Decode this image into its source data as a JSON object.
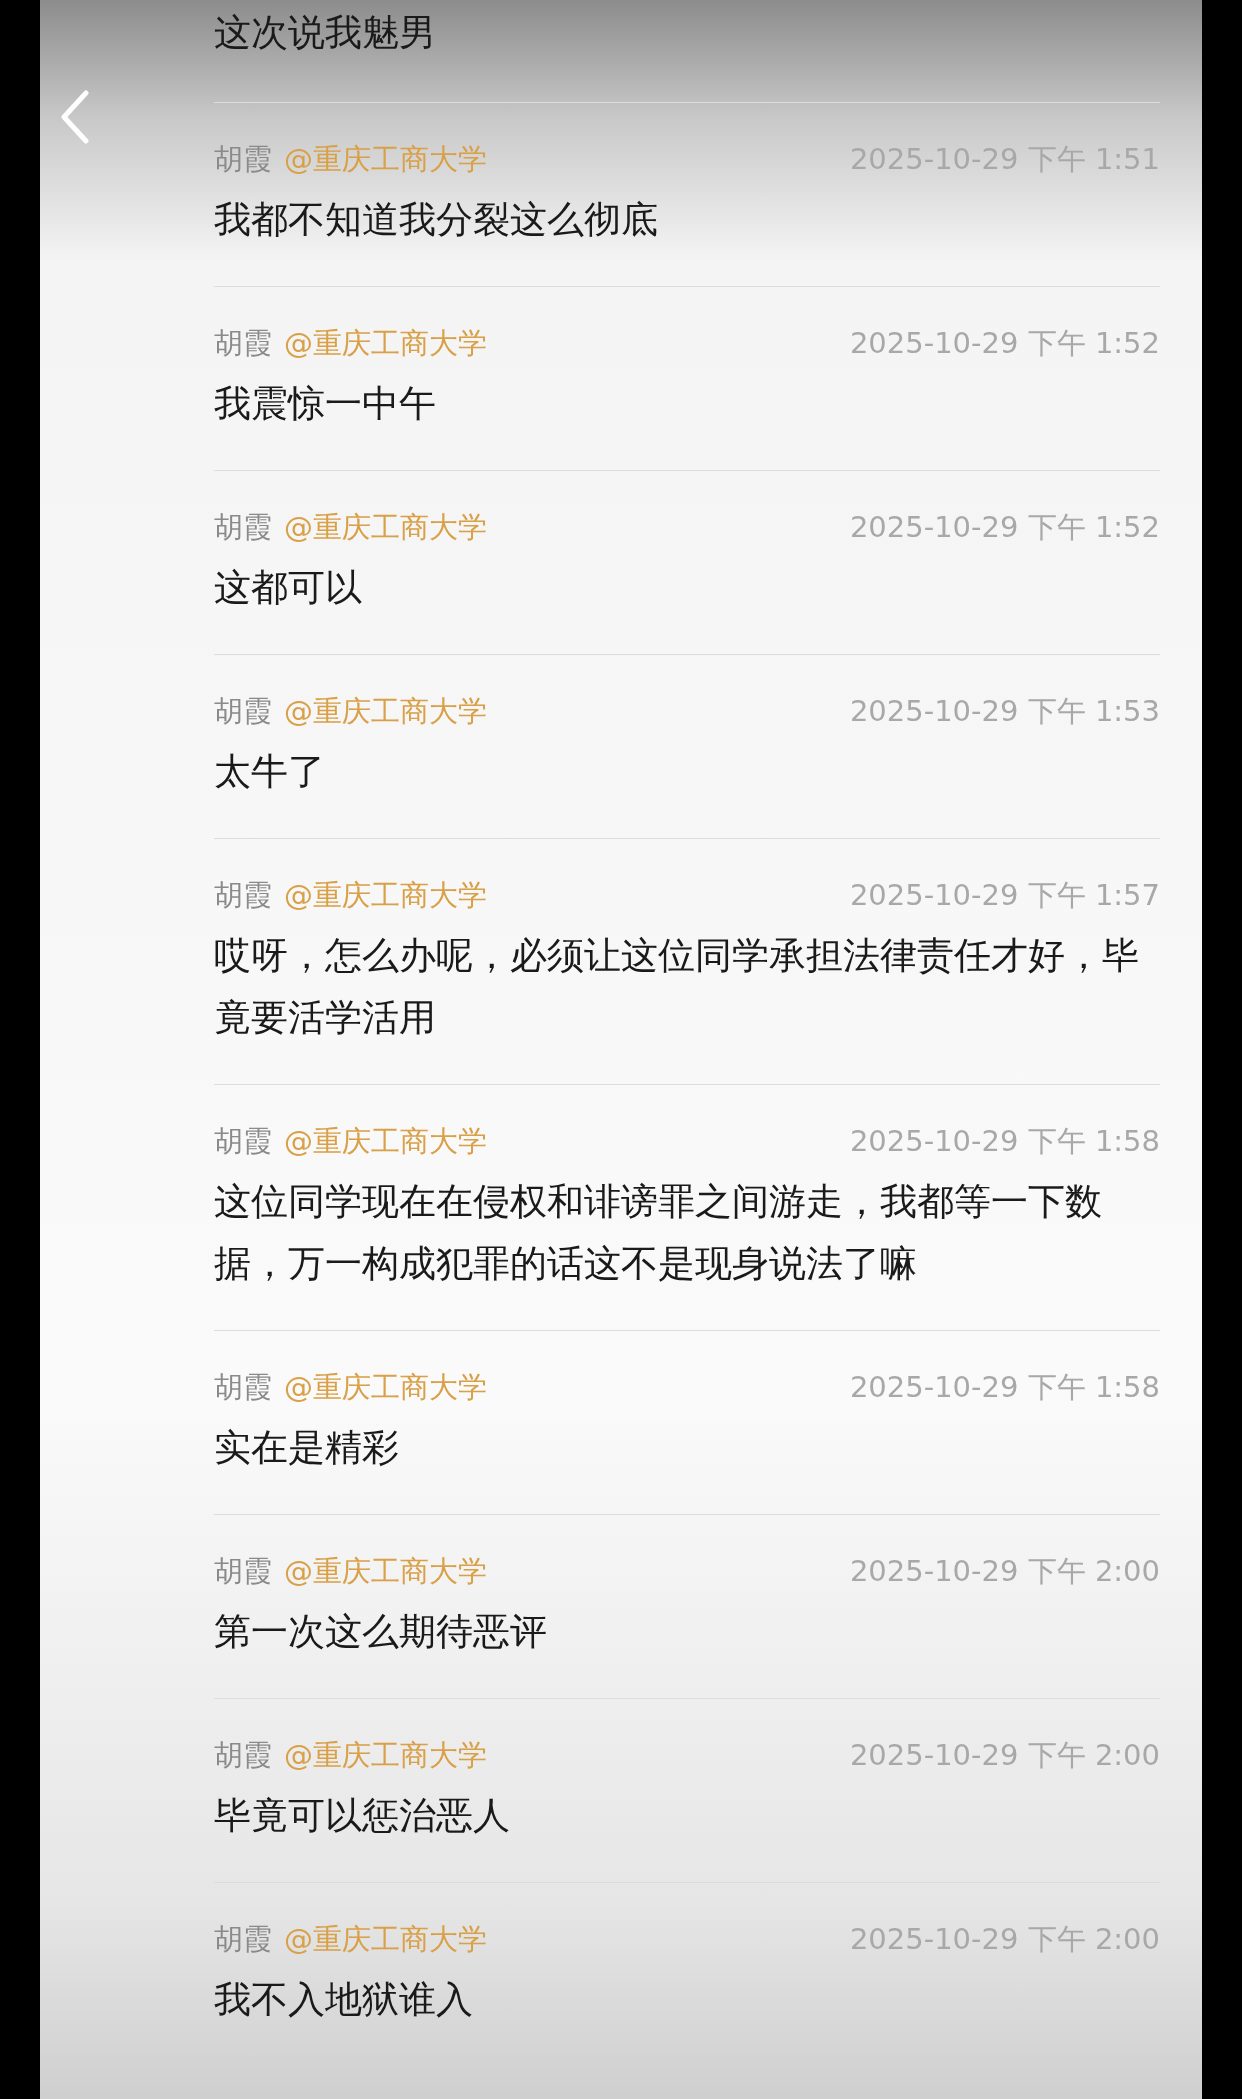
{
  "partial_comment": {
    "text": "这次说我魅男"
  },
  "comments": [
    {
      "author": "胡霞",
      "school": "@重庆工商大学",
      "time": "2025-10-29 下午 1:51",
      "text": "我都不知道我分裂这么彻底"
    },
    {
      "author": "胡霞",
      "school": "@重庆工商大学",
      "time": "2025-10-29 下午 1:52",
      "text": "我震惊一中午"
    },
    {
      "author": "胡霞",
      "school": "@重庆工商大学",
      "time": "2025-10-29 下午 1:52",
      "text": "这都可以"
    },
    {
      "author": "胡霞",
      "school": "@重庆工商大学",
      "time": "2025-10-29 下午 1:53",
      "text": "太牛了"
    },
    {
      "author": "胡霞",
      "school": "@重庆工商大学",
      "time": "2025-10-29 下午 1:57",
      "text": "哎呀，怎么办呢，必须让这位同学承担法律责任才好，毕竟要活学活用"
    },
    {
      "author": "胡霞",
      "school": "@重庆工商大学",
      "time": "2025-10-29 下午 1:58",
      "text": "这位同学现在在侵权和诽谤罪之间游走，我都等一下数据，万一构成犯罪的话这不是现身说法了嘛"
    },
    {
      "author": "胡霞",
      "school": "@重庆工商大学",
      "time": "2025-10-29 下午 1:58",
      "text": "实在是精彩"
    },
    {
      "author": "胡霞",
      "school": "@重庆工商大学",
      "time": "2025-10-29 下午 2:00",
      "text": "第一次这么期待恶评"
    },
    {
      "author": "胡霞",
      "school": "@重庆工商大学",
      "time": "2025-10-29 下午 2:00",
      "text": "毕竟可以惩治恶人"
    },
    {
      "author": "胡霞",
      "school": "@重庆工商大学",
      "time": "2025-10-29 下午 2:00",
      "text": "我不入地狱谁入"
    }
  ]
}
